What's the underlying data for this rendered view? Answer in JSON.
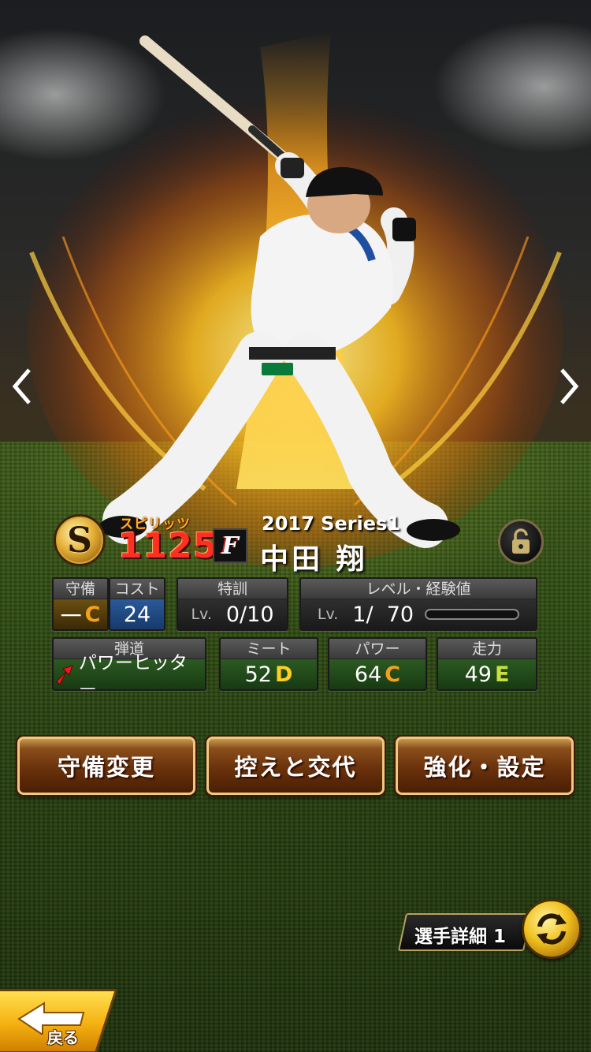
{
  "header": {
    "rarity": "S",
    "spirit_label": "スピリッツ",
    "spirit_value": "1125",
    "team_logo": "F",
    "series": "2017 Series1",
    "player_name": "中田 翔"
  },
  "stats": {
    "position": {
      "label": "守備",
      "value": "一",
      "grade": "C"
    },
    "cost": {
      "label": "コスト",
      "value": "24"
    },
    "training": {
      "label": "特訓",
      "lv_prefix": "Lv.",
      "value": "0/10"
    },
    "level": {
      "label": "レベル・経験値",
      "lv_prefix": "Lv.",
      "value": "1/  70",
      "exp_progress": 0.0
    },
    "trajectory": {
      "label": "弾道",
      "value": "パワーヒッター"
    },
    "meet": {
      "label": "ミート",
      "value": "52",
      "grade": "D"
    },
    "power": {
      "label": "パワー",
      "value": "64",
      "grade": "C"
    },
    "speed": {
      "label": "走力",
      "value": "49",
      "grade": "E"
    }
  },
  "buttons": {
    "defense_change": "守備変更",
    "bench_swap": "控えと交代",
    "enhance_settings": "強化・設定"
  },
  "detail": {
    "label": "選手詳細 1"
  },
  "back": {
    "label": "戻る"
  },
  "icons": {
    "prev": "chevron-left-icon",
    "next": "chevron-right-icon",
    "lock": "lock-icon",
    "swap": "swap-icon",
    "trajectory": "arrow-up-right-icon",
    "back": "arrow-left-icon"
  },
  "colors": {
    "grade_c": "#f3a020",
    "grade_d": "#ffd020",
    "grade_e": "#c8e040",
    "spirit": "#ff3020",
    "button_border": "#f0c880"
  }
}
